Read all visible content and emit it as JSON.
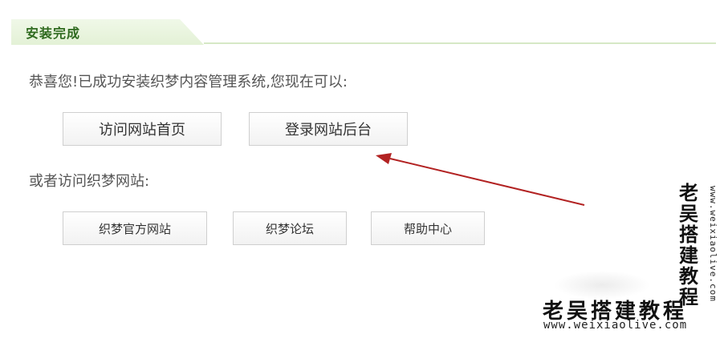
{
  "header": {
    "title": "安装完成"
  },
  "main": {
    "congrats_text": "恭喜您!已成功安装织梦内容管理系统,您现在可以:",
    "primary_buttons": {
      "visit_home": "访问网站首页",
      "login_admin": "登录网站后台"
    },
    "or_text": "或者访问织梦网站:",
    "secondary_buttons": {
      "official_site": "织梦官方网站",
      "forum": "织梦论坛",
      "help_center": "帮助中心"
    }
  },
  "watermark": {
    "vertical_cn": "老吴搭建教程",
    "vertical_url": "www.weixiaolive.com",
    "horizontal_cn": "老吴搭建教程",
    "horizontal_url": "www.weixiaolive.com"
  },
  "colors": {
    "header_text": "#2f6a1f",
    "header_tab": "#e3f1d6",
    "arrow": "#b22222"
  }
}
